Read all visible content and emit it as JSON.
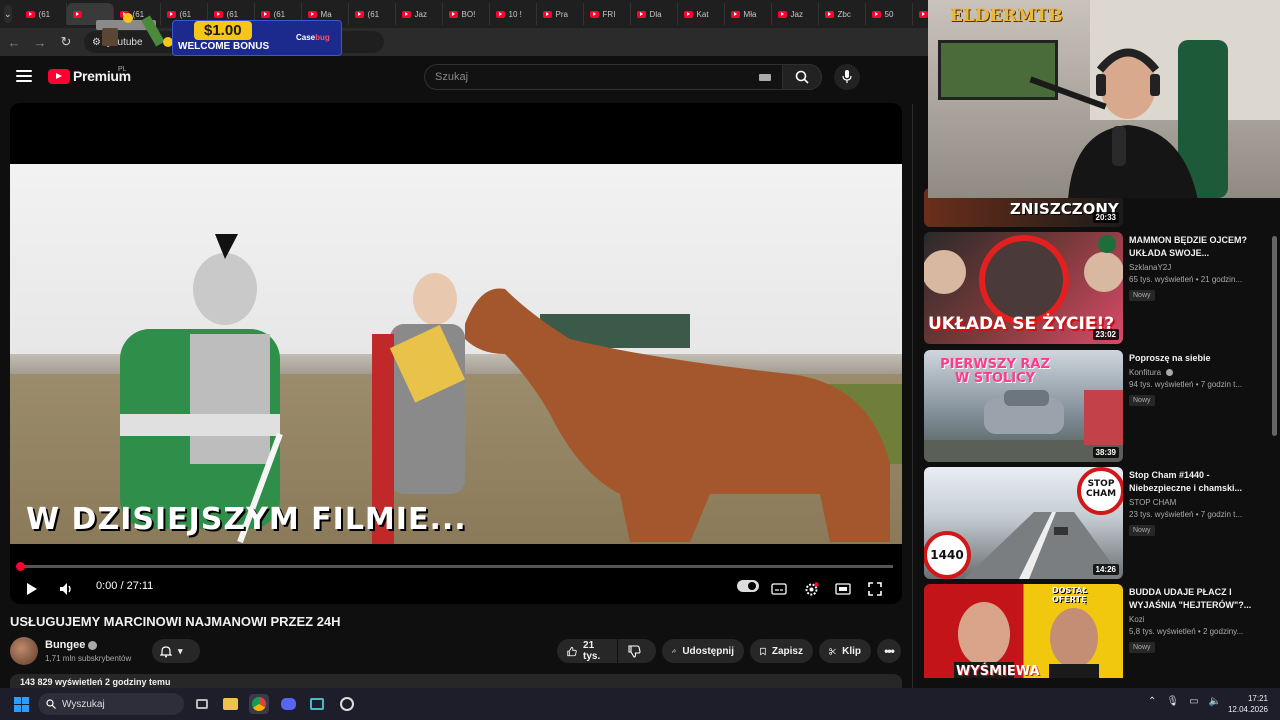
{
  "browser": {
    "tabs": [
      {
        "label": "(61"
      },
      {
        "label": ""
      },
      {
        "label": "(61"
      },
      {
        "label": "(61"
      },
      {
        "label": "(61"
      },
      {
        "label": "(61"
      },
      {
        "label": "Ma"
      },
      {
        "label": "(61"
      },
      {
        "label": "Jaz"
      },
      {
        "label": "BO!"
      },
      {
        "label": "10 !"
      },
      {
        "label": "Pra"
      },
      {
        "label": "FRI"
      },
      {
        "label": "Dla"
      },
      {
        "label": "Kat"
      },
      {
        "label": "Mła"
      },
      {
        "label": "Jaz"
      },
      {
        "label": "Zbc"
      },
      {
        "label": "50"
      },
      {
        "label": "NA"
      }
    ],
    "url": "youtube"
  },
  "ad": {
    "amount": "$1.00",
    "bonus": "WELCOME BONUS",
    "brand_a": "Case",
    "brand_b": "bug"
  },
  "header": {
    "logo_text": "Premium",
    "country": "PL",
    "search_placeholder": "Szukaj"
  },
  "player": {
    "overlay_text": "W DZISIEJSZYM FILMIE...",
    "time": "0:00 / 27:11",
    "progress": 0.0
  },
  "video": {
    "title": "USŁUGUJEMY MARCINOWI NAJMANOWI PRZEZ 24H",
    "channel": "Bungee",
    "subscribers": "1,71 mln subskrybentów",
    "likes": "21 tys.",
    "share": "Udostępnij",
    "save": "Zapisz",
    "clip": "Klip",
    "views_line": "143 829 wyświetleń  2 godziny temu"
  },
  "webcam": {
    "logo": "ELDERMTB"
  },
  "recommendations": [
    {
      "title": "",
      "channel": "",
      "meta": "",
      "badge": "",
      "duration": "20:33",
      "thumb_text": "ZNISZCZONY"
    },
    {
      "title": "MAMMON BĘDZIE OJCEM? UKŁADA SWOJE...",
      "channel": "SzklanaY2J",
      "meta": "65 tys. wyświetleń • 21 godzin...",
      "badge": "Nowy",
      "duration": "23:02",
      "thumb_text": "UKŁADA SE ŻYCIE!?"
    },
    {
      "title": "Poproszę na siebie",
      "channel": "Konfitura",
      "meta": "94 tys. wyświetleń • 7 godzin t...",
      "badge": "Nowy",
      "duration": "38:39",
      "thumb_text": "PIERWSZY RAZ W STOLICY"
    },
    {
      "title": "Stop Cham #1440 - Niebezpieczne i chamski...",
      "channel": "STOP CHAM",
      "meta": "23 tys. wyświetleń • 7 godzin t...",
      "badge": "Nowy",
      "duration": "14:26",
      "thumb_text": "STOP CHAM",
      "thumb_num": "1440"
    },
    {
      "title": "BUDDA UDAJE PŁACZ I WYJAŚNIA \"HEJTERÓW\"?...",
      "channel": "Kozi",
      "meta": "5,8 tys. wyświetleń • 2 godziny...",
      "badge": "Nowy",
      "duration": "",
      "thumb_text": "WYŚMIEWA",
      "thumb_tag": "DOSTAŁ OFERTĘ"
    }
  ],
  "taskbar": {
    "search": "Wyszukaj",
    "time": "17:21",
    "date": "12.04.2026"
  }
}
